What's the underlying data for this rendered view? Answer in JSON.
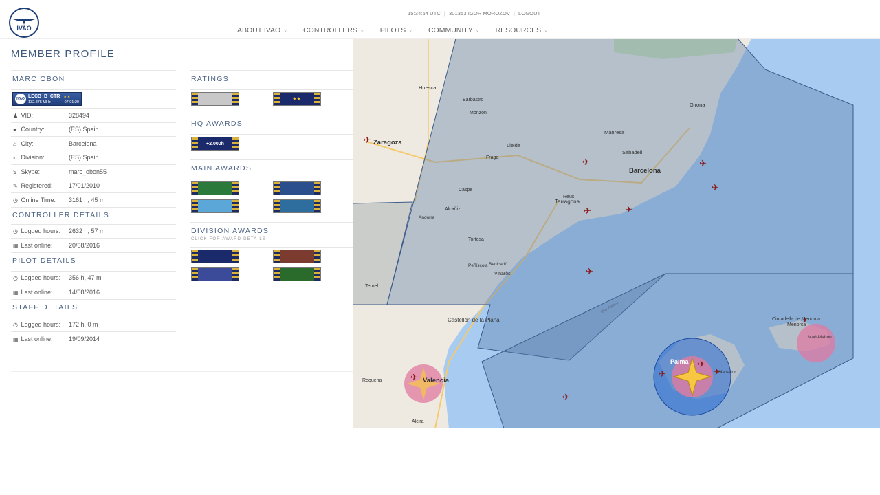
{
  "header": {
    "logo_text": "IVAO",
    "time": "15:34:54 UTC",
    "user": "301353 IGOR MOROZOV",
    "logout": "LOGOUT",
    "nav": [
      {
        "label": "ABOUT IVAO"
      },
      {
        "label": "CONTROLLERS"
      },
      {
        "label": "PILOTS"
      },
      {
        "label": "COMMUNITY"
      },
      {
        "label": "RESOURCES"
      }
    ]
  },
  "profile": {
    "title": "MEMBER PROFILE",
    "name": "MARC OBON",
    "atc_badge": {
      "callsign": "LECB_B_CTR",
      "freq": "132.875 MHz",
      "time": "07:01:20",
      "logo": "IVAO",
      "stars": "★★"
    },
    "fields": [
      {
        "icon": "user-icon",
        "glyph": "♟",
        "label": "VID:",
        "value": "328494"
      },
      {
        "icon": "globe-icon",
        "glyph": "●",
        "label": "Country:",
        "value": "(ES) Spain"
      },
      {
        "icon": "home-icon",
        "glyph": "⌂",
        "label": "City:",
        "value": "Barcelona"
      },
      {
        "icon": "division-icon",
        "glyph": "◐",
        "label": "Division:",
        "value": "(ES) Spain"
      },
      {
        "icon": "skype-icon",
        "glyph": "S",
        "label": "Skype:",
        "value": "marc_obon55"
      },
      {
        "icon": "edit-icon",
        "glyph": "✎",
        "label": "Registered:",
        "value": "17/01/2010"
      },
      {
        "icon": "clock-icon",
        "glyph": "◷",
        "label": "Online Time:",
        "value": "3161 h, 45 m"
      }
    ],
    "controller": {
      "heading": "CONTROLLER DETAILS",
      "rows": [
        {
          "icon": "clock-icon",
          "glyph": "◷",
          "label": "Logged hours:",
          "value": "2632 h, 57 m"
        },
        {
          "icon": "calendar-icon",
          "glyph": "▦",
          "label": "Last online:",
          "value": "20/08/2016"
        }
      ]
    },
    "pilot": {
      "heading": "PILOT DETAILS",
      "rows": [
        {
          "icon": "clock-icon",
          "glyph": "◷",
          "label": "Logged hours:",
          "value": "356 h, 47 m"
        },
        {
          "icon": "calendar-icon",
          "glyph": "▦",
          "label": "Last online:",
          "value": "14/08/2016"
        }
      ]
    },
    "staff": {
      "heading": "STAFF DETAILS",
      "rows": [
        {
          "icon": "clock-icon",
          "glyph": "◷",
          "label": "Logged hours:",
          "value": "172 h, 0 m"
        },
        {
          "icon": "calendar-icon",
          "glyph": "▦",
          "label": "Last online:",
          "value": "19/09/2014"
        }
      ]
    }
  },
  "awards": {
    "ratings_heading": "RATINGS",
    "ratings": [
      {
        "text": "",
        "color": "#c8c8c8"
      },
      {
        "text": "★★",
        "color": "#1b2a6b"
      }
    ],
    "hq_heading": "HQ AWARDS",
    "hq": [
      {
        "text": "+2.000h",
        "color": "#1b2a6b"
      }
    ],
    "main_heading": "MAIN AWARDS",
    "main": [
      {
        "text": "",
        "color": "#2b7a3c"
      },
      {
        "text": "",
        "color": "#2b4e8c"
      },
      {
        "text": "",
        "color": "#5aa7d8"
      },
      {
        "text": "",
        "color": "#2d6e9e"
      }
    ],
    "division_heading": "DIVISION AWARDS",
    "division_sub": "CLICK FOR AWARD DETAILS",
    "division": [
      {
        "text": "",
        "color": "#1b2a6b"
      },
      {
        "text": "",
        "color": "#7b3b2e"
      },
      {
        "text": "",
        "color": "#3b4b9a"
      },
      {
        "text": "",
        "color": "#2a6a2a"
      }
    ]
  },
  "map": {
    "labels": [
      "Zaragoza",
      "Barcelona",
      "Tarragona",
      "Valencia",
      "Castellón de la Plana",
      "Palma",
      "Menorca",
      "Huesca",
      "Lleida",
      "Girona",
      "Andorra",
      "Teruel",
      "Vinaròs",
      "Tortosa",
      "Reus",
      "Sabadell",
      "Manresa",
      "Barbastro",
      "Monzón",
      "Fraga",
      "Alcañiz",
      "Caspe",
      "Requena",
      "Alcira",
      "Manacor",
      "Ciutadella de Menorca",
      "Maó-Mahón",
      "Benicarló",
      "Peñíscola",
      "Mar Balear"
    ]
  }
}
